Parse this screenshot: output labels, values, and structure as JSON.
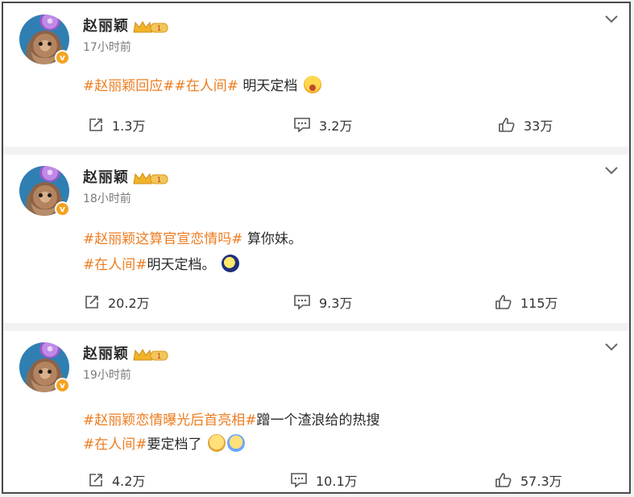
{
  "posts": [
    {
      "user": {
        "name": "赵丽颖",
        "badge_level": "1",
        "verified_mark": "v"
      },
      "time": "17小时前",
      "lines": [
        {
          "tag": "#赵丽颖回应##在人间#",
          "text": "明天定档",
          "emoji": "shocked-face-emoji"
        }
      ],
      "stats": {
        "share": "1.3万",
        "comment": "3.2万",
        "like": "33万"
      }
    },
    {
      "user": {
        "name": "赵丽颖",
        "badge_level": "1",
        "verified_mark": "v"
      },
      "time": "18小时前",
      "lines": [
        {
          "tag": "#赵丽颖这算官宣恋情吗#",
          "text": "算你妹。",
          "emoji": ""
        },
        {
          "tag": "#在人间#",
          "text": "明天定档。",
          "emoji": "moon-emoji"
        }
      ],
      "stats": {
        "share": "20.2万",
        "comment": "9.3万",
        "like": "115万"
      }
    },
    {
      "user": {
        "name": "赵丽颖",
        "badge_level": "1",
        "verified_mark": "v"
      },
      "time": "19小时前",
      "lines": [
        {
          "tag": "#赵丽颖恋情曝光后首亮相#",
          "text": "蹭一个渣浪给的热搜",
          "emoji": ""
        },
        {
          "tag": "#在人间#",
          "text": "要定档了",
          "emoji": "party-face-emoji"
        }
      ],
      "stats": {
        "share": "4.2万",
        "comment": "10.1万",
        "like": "57.3万"
      }
    }
  ],
  "colors": {
    "topic": "#ec7d21",
    "text": "#2a2a2a",
    "muted": "#7a7a7a",
    "badge": "#f5a21f"
  }
}
